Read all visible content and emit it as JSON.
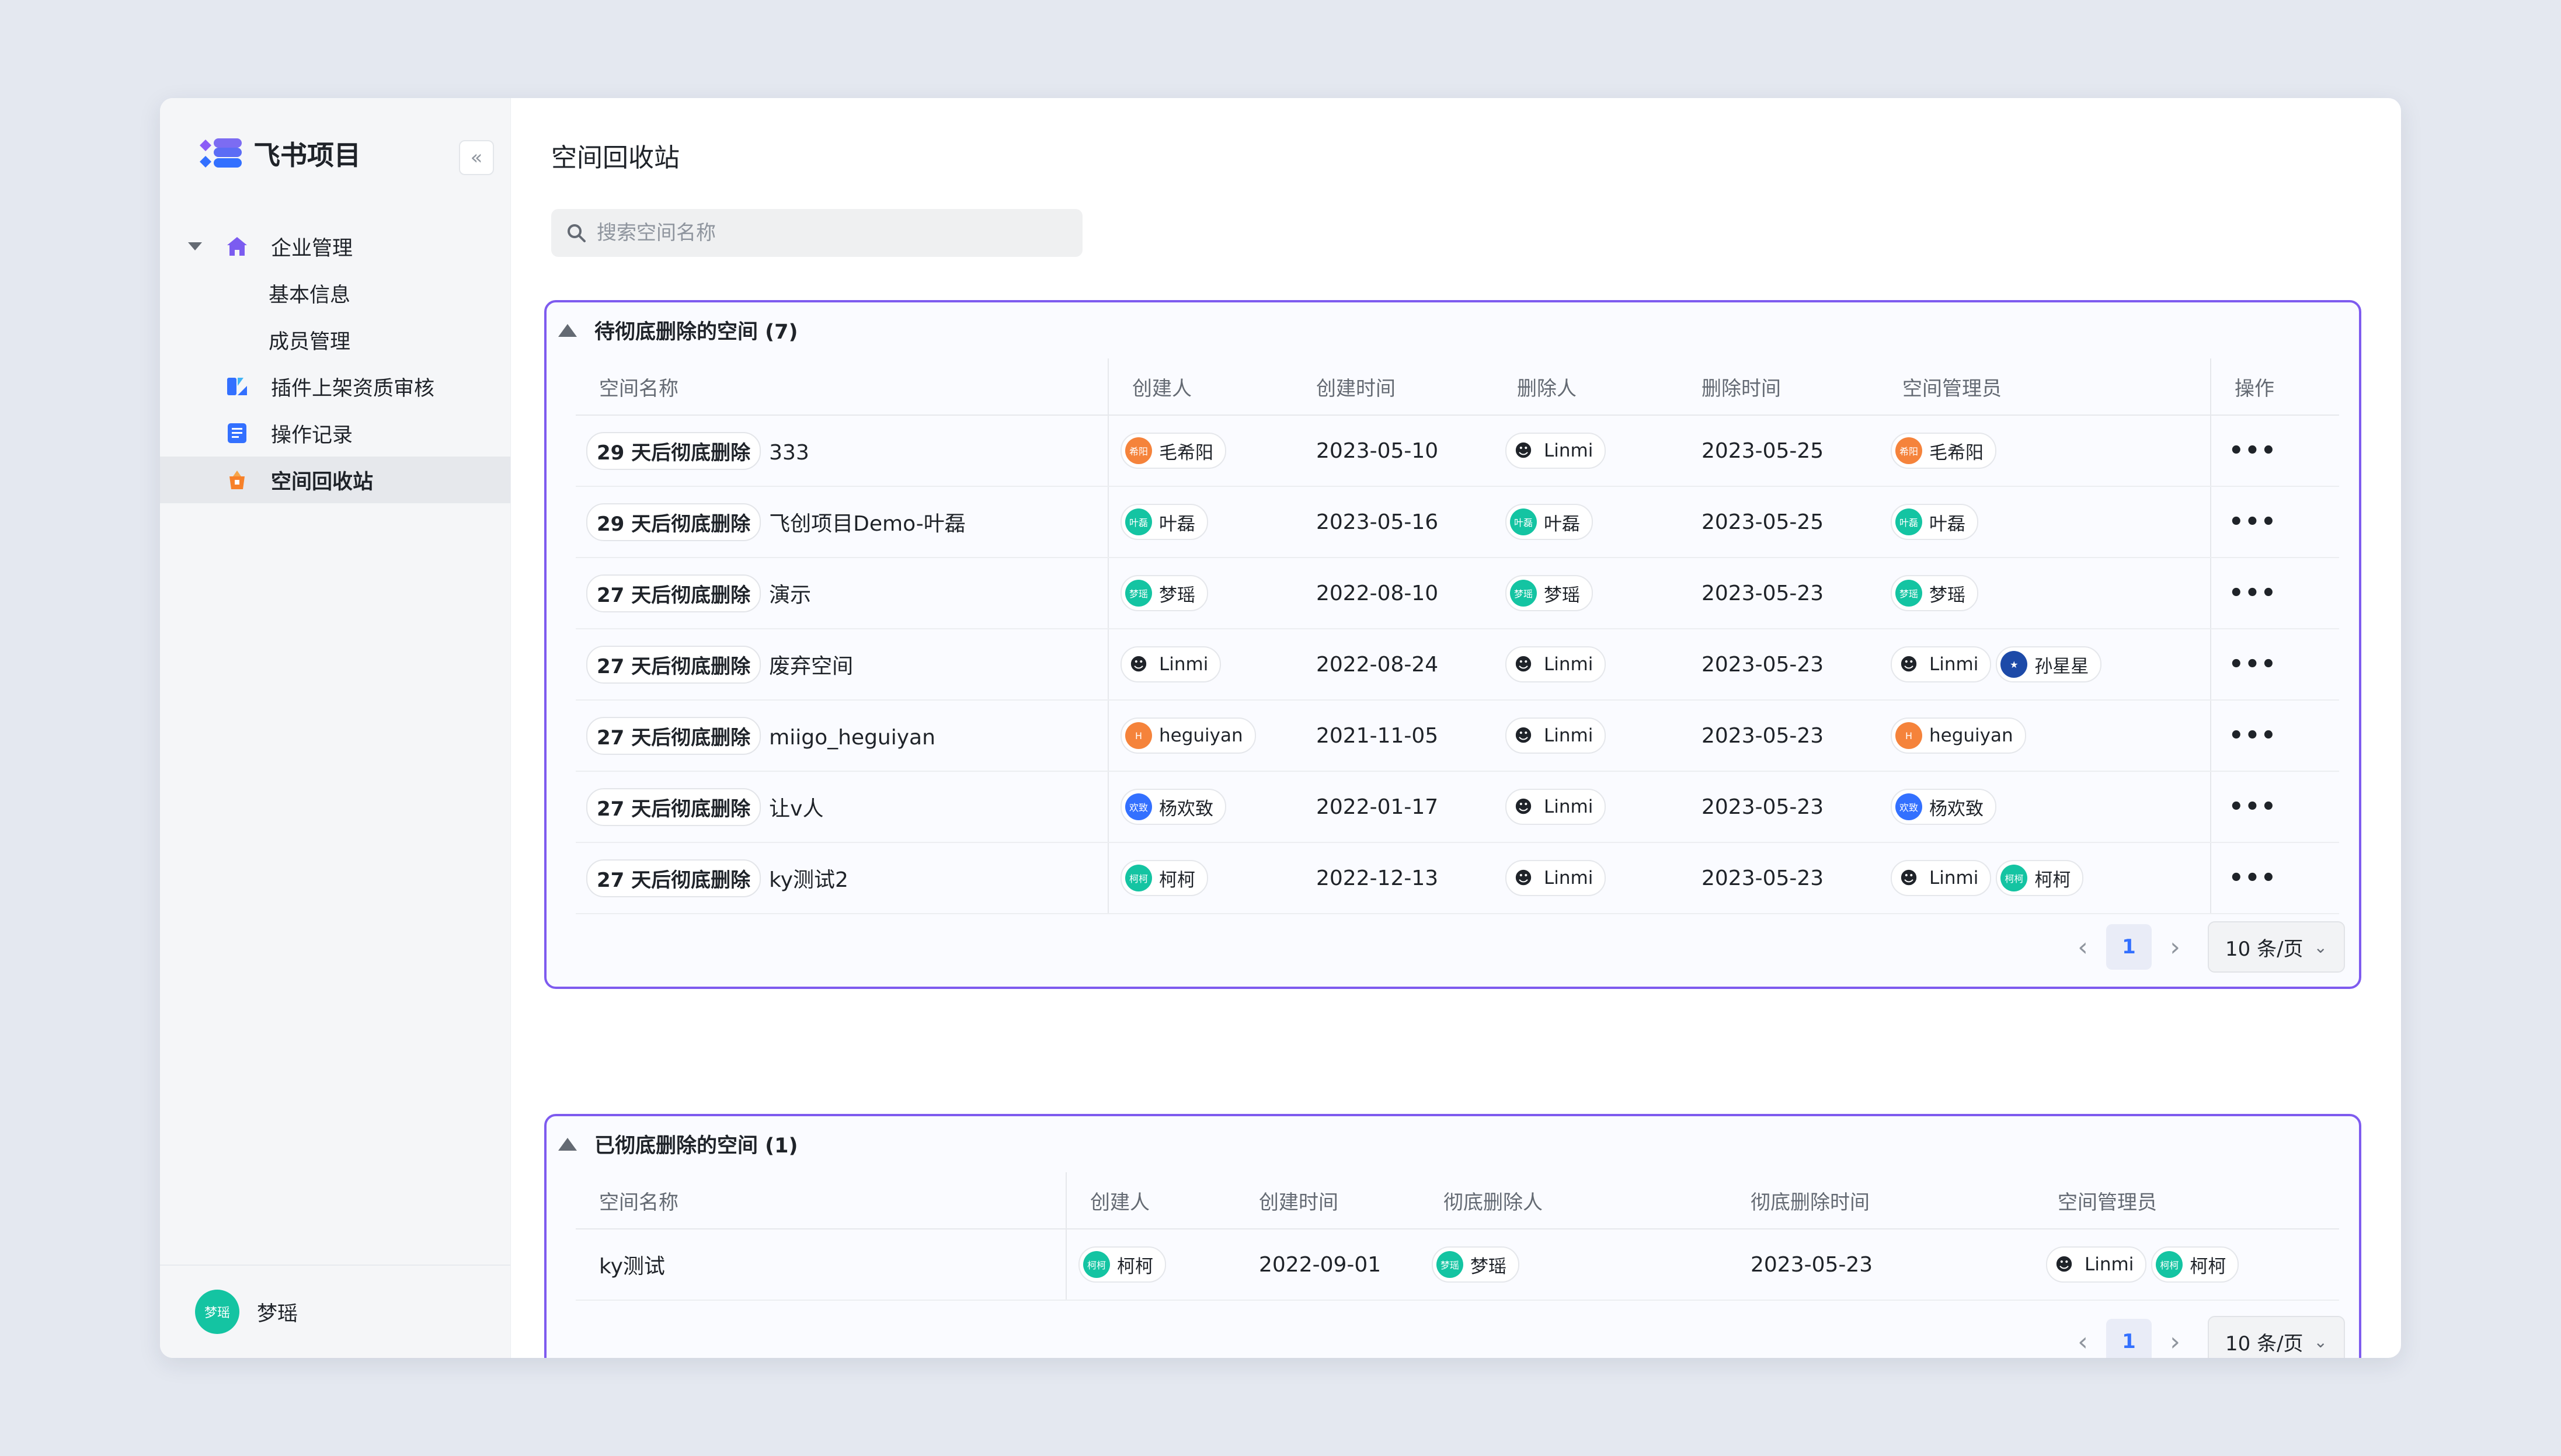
{
  "app": {
    "name": "飞书项目",
    "collapse_icon": "«"
  },
  "sidebar": {
    "items": [
      {
        "label": "企业管理",
        "icon": "home-icon"
      },
      {
        "label": "基本信息"
      },
      {
        "label": "成员管理"
      },
      {
        "label": "插件上架资质审核",
        "icon": "plugin-icon"
      },
      {
        "label": "操作记录",
        "icon": "document-icon"
      },
      {
        "label": "空间回收站",
        "icon": "recycle-bin-icon",
        "active": true
      }
    ],
    "user": {
      "name": "梦瑶",
      "avatar_text": "梦瑶"
    }
  },
  "page": {
    "title": "空间回收站",
    "search_placeholder": "搜索空间名称"
  },
  "pending": {
    "title": "待彻底删除的空间 (7)",
    "columns": [
      "空间名称",
      "创建人",
      "创建时间",
      "删除人",
      "删除时间",
      "空间管理员",
      "操作"
    ],
    "rows": [
      {
        "tag": "29 天后彻底删除",
        "name": "333",
        "creator": "毛希阳",
        "created": "2023-05-10",
        "deleter": "Linmi",
        "deleted": "2023-05-25",
        "admins": [
          "毛希阳"
        ]
      },
      {
        "tag": "29 天后彻底删除",
        "name": "飞创项目Demo-叶磊",
        "creator": "叶磊",
        "created": "2023-05-16",
        "deleter": "叶磊",
        "deleted": "2023-05-25",
        "admins": [
          "叶磊"
        ]
      },
      {
        "tag": "27 天后彻底删除",
        "name": "演示",
        "creator": "梦瑶",
        "created": "2022-08-10",
        "deleter": "梦瑶",
        "deleted": "2023-05-23",
        "admins": [
          "梦瑶"
        ]
      },
      {
        "tag": "27 天后彻底删除",
        "name": "废弃空间",
        "creator": "Linmi",
        "created": "2022-08-24",
        "deleter": "Linmi",
        "deleted": "2023-05-23",
        "admins": [
          "Linmi",
          "孙星星"
        ]
      },
      {
        "tag": "27 天后彻底删除",
        "name": "miigo_heguiyan",
        "creator": "heguiyan",
        "created": "2021-11-05",
        "deleter": "Linmi",
        "deleted": "2023-05-23",
        "admins": [
          "heguiyan"
        ]
      },
      {
        "tag": "27 天后彻底删除",
        "name": "让v人",
        "creator": "杨欢致",
        "created": "2022-01-17",
        "deleter": "Linmi",
        "deleted": "2023-05-23",
        "admins": [
          "杨欢致"
        ]
      },
      {
        "tag": "27 天后彻底删除",
        "name": "ky测试2",
        "creator": "柯柯",
        "created": "2022-12-13",
        "deleter": "Linmi",
        "deleted": "2023-05-23",
        "admins": [
          "Linmi",
          "柯柯"
        ]
      }
    ],
    "more_label": "•••",
    "pager": {
      "prev": "‹",
      "page": "1",
      "next": "›",
      "size": "10 条/页",
      "size_chevron": "⌄"
    }
  },
  "deleted": {
    "title": "已彻底删除的空间 (1)",
    "columns": [
      "空间名称",
      "创建人",
      "创建时间",
      "彻底删除人",
      "彻底删除时间",
      "空间管理员"
    ],
    "rows": [
      {
        "name": "ky测试",
        "creator": "柯柯",
        "created": "2022-09-01",
        "deleter": "梦瑶",
        "deleted": "2023-05-23",
        "admins": [
          "Linmi",
          "柯柯"
        ]
      }
    ],
    "pager": {
      "prev": "‹",
      "page": "1",
      "next": "›",
      "size": "10 条/页",
      "size_chevron": "⌄"
    }
  },
  "avatars": {
    "毛希阳": {
      "text": "希阳",
      "color": "#f5833b"
    },
    "叶磊": {
      "text": "叶磊",
      "color": "#14c4a2"
    },
    "梦瑶": {
      "text": "梦瑶",
      "color": "#14c4a2"
    },
    "Linmi": {
      "text": "☻",
      "color": "#ffffff"
    },
    "heguiyan": {
      "text": "H",
      "color": "#f5833b"
    },
    "杨欢致": {
      "text": "欢致",
      "color": "#3370ff"
    },
    "柯柯": {
      "text": "柯柯",
      "color": "#14c4a2"
    },
    "孙星星": {
      "text": "★",
      "color": "#1d4aa8"
    }
  }
}
